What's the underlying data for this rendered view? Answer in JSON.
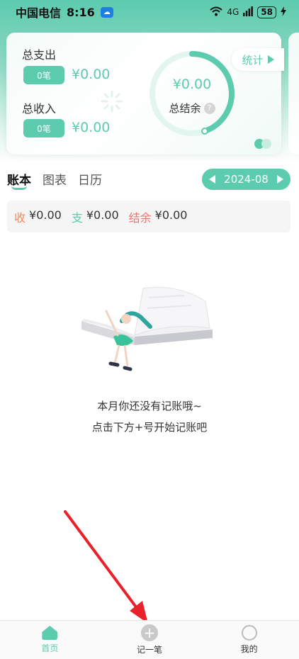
{
  "status_bar": {
    "carrier": "中国电信",
    "time": "8:16",
    "network": "4G",
    "battery": "58"
  },
  "summary_card": {
    "total_expense_label": "总支出",
    "expense_count": "0笔",
    "expense_amount": "¥0.00",
    "total_income_label": "总收入",
    "income_count": "0笔",
    "income_amount": "¥0.00",
    "balance_amount": "¥0.00",
    "balance_label": "总结余",
    "help_symbol": "?",
    "stats_button_label": "统计"
  },
  "tabs": [
    {
      "label": "账本",
      "active": true
    },
    {
      "label": "图表",
      "active": false
    },
    {
      "label": "日历",
      "active": false
    }
  ],
  "month": "2024-08",
  "summary_strip": {
    "income_key": "收",
    "income_value": "¥0.00",
    "expense_key": "支",
    "expense_value": "¥0.00",
    "balance_key": "结余",
    "balance_value": "¥0.00"
  },
  "empty_state": {
    "line1": "本月你还没有记账哦~",
    "line2": "点击下方+号开始记账吧"
  },
  "bottom_nav": [
    {
      "label": "首页",
      "icon": "home-icon",
      "active": true
    },
    {
      "label": "记一笔",
      "icon": "add-icon",
      "active": false
    },
    {
      "label": "我的",
      "icon": "profile-icon",
      "active": false
    }
  ],
  "colors": {
    "accent": "#5ccbae",
    "income_key": "#f08a55",
    "balance_key": "#f0736f",
    "annotation_arrow": "#e8212a"
  }
}
